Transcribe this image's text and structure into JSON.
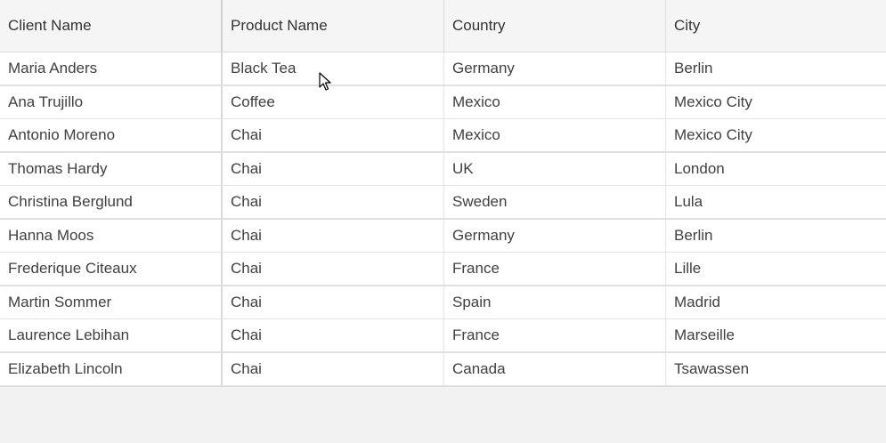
{
  "table": {
    "columns": [
      "Client Name",
      "Product Name",
      "Country",
      "City"
    ],
    "rows": [
      [
        "Maria Anders",
        "Black Tea",
        "Germany",
        "Berlin"
      ],
      [
        "Ana Trujillo",
        "Coffee",
        "Mexico",
        "Mexico City"
      ],
      [
        "Antonio Moreno",
        "Chai",
        "Mexico",
        "Mexico City"
      ],
      [
        "Thomas Hardy",
        "Chai",
        "UK",
        "London"
      ],
      [
        "Christina Berglund",
        "Chai",
        "Sweden",
        "Lula"
      ],
      [
        "Hanna Moos",
        "Chai",
        "Germany",
        "Berlin"
      ],
      [
        "Frederique Citeaux",
        "Chai",
        "France",
        "Lille"
      ],
      [
        "Martin Sommer",
        "Chai",
        "Spain",
        "Madrid"
      ],
      [
        "Laurence Lebihan",
        "Chai",
        "France",
        "Marseille"
      ],
      [
        "Elizabeth Lincoln",
        "Chai",
        "Canada",
        "Tsawassen"
      ]
    ]
  },
  "cursor": {
    "icon": "mouse-pointer-icon"
  }
}
